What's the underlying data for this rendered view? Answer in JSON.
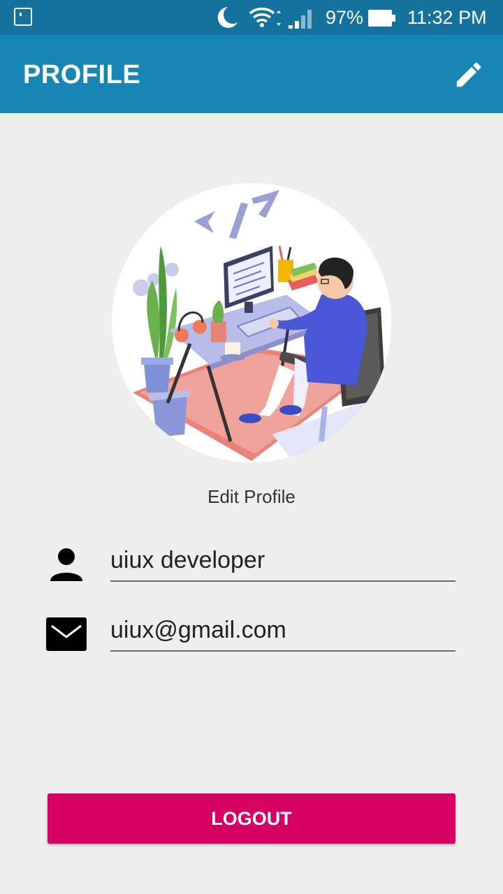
{
  "status_bar": {
    "battery_percent": "97%",
    "time": "11:32 PM",
    "icons": [
      "notification-icon",
      "moon-icon",
      "wifi-icon",
      "signal-icon",
      "battery-icon"
    ]
  },
  "app_bar": {
    "title": "PROFILE",
    "action_icon": "edit-pencil-icon"
  },
  "profile": {
    "avatar_icon": "developer-desk-illustration",
    "edit_label": "Edit Profile",
    "name": "uiux developer",
    "email": "uiux@gmail.com",
    "name_icon": "person-icon",
    "email_icon": "mail-icon"
  },
  "actions": {
    "logout_label": "LOGOUT"
  },
  "colors": {
    "status_bar": "#15719e",
    "app_bar": "#1886b5",
    "background": "#eeeeee",
    "logout_button": "#d50061"
  }
}
